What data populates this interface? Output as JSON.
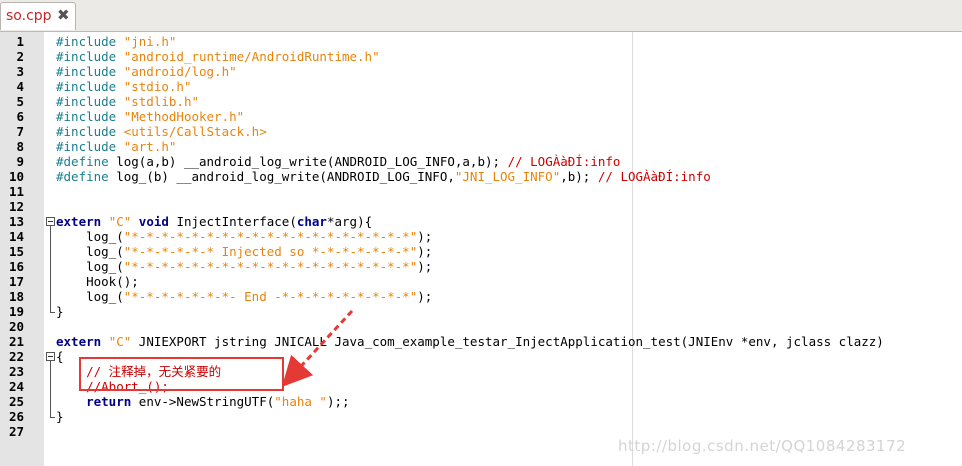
{
  "tab": {
    "label": "so.cpp",
    "close_glyph": "✖"
  },
  "editor": {
    "lines": [
      {
        "n": "1",
        "parts": [
          [
            "pp",
            "#include "
          ],
          [
            "str",
            "\"jni.h\""
          ]
        ]
      },
      {
        "n": "2",
        "parts": [
          [
            "pp",
            "#include "
          ],
          [
            "str",
            "\"android_runtime/AndroidRuntime.h\""
          ]
        ]
      },
      {
        "n": "3",
        "parts": [
          [
            "pp",
            "#include "
          ],
          [
            "str",
            "\"android/log.h\""
          ]
        ]
      },
      {
        "n": "4",
        "parts": [
          [
            "pp",
            "#include "
          ],
          [
            "str",
            "\"stdio.h\""
          ]
        ]
      },
      {
        "n": "5",
        "parts": [
          [
            "pp",
            "#include "
          ],
          [
            "str",
            "\"stdlib.h\""
          ]
        ]
      },
      {
        "n": "6",
        "parts": [
          [
            "pp",
            "#include "
          ],
          [
            "str",
            "\"MethodHooker.h\""
          ]
        ]
      },
      {
        "n": "7",
        "parts": [
          [
            "pp",
            "#include "
          ],
          [
            "str",
            "<utils/CallStack.h>"
          ]
        ]
      },
      {
        "n": "8",
        "parts": [
          [
            "pp",
            "#include "
          ],
          [
            "str",
            "\"art.h\""
          ]
        ]
      },
      {
        "n": "9",
        "parts": [
          [
            "pp",
            "#define "
          ],
          [
            "txt",
            "log(a,b) __android_log_write(ANDROID_LOG_INFO,a,b); "
          ],
          [
            "cmt",
            "// LOGÀàÐÍ:info"
          ]
        ]
      },
      {
        "n": "10",
        "parts": [
          [
            "pp",
            "#define "
          ],
          [
            "txt",
            "log_(b) __android_log_write(ANDROID_LOG_INFO,"
          ],
          [
            "str",
            "\"JNI_LOG_INFO\""
          ],
          [
            "txt",
            ",b); "
          ],
          [
            "cmt",
            "// LOGÀàÐÍ:info"
          ]
        ]
      },
      {
        "n": "11",
        "parts": []
      },
      {
        "n": "12",
        "parts": []
      },
      {
        "n": "13",
        "parts": [
          [
            "kw",
            "extern "
          ],
          [
            "str",
            "\"C\" "
          ],
          [
            "kw",
            "void "
          ],
          [
            "txt",
            "InjectInterface("
          ],
          [
            "kw",
            "char"
          ],
          [
            "txt",
            "*arg){"
          ]
        ]
      },
      {
        "n": "14",
        "parts": [
          [
            "txt",
            "    log_("
          ],
          [
            "str",
            "\"*-*-*-*-*-*-*-*-*-*-*-*-*-*-*-*-*-*-*\""
          ],
          [
            "txt",
            ");"
          ]
        ]
      },
      {
        "n": "15",
        "parts": [
          [
            "txt",
            "    log_("
          ],
          [
            "str",
            "\"*-*-*-*-*-* Injected so *-*-*-*-*-*-*\""
          ],
          [
            "txt",
            ");"
          ]
        ]
      },
      {
        "n": "16",
        "parts": [
          [
            "txt",
            "    log_("
          ],
          [
            "str",
            "\"*-*-*-*-*-*-*-*-*-*-*-*-*-*-*-*-*-*-*\""
          ],
          [
            "txt",
            ");"
          ]
        ]
      },
      {
        "n": "17",
        "parts": [
          [
            "txt",
            "    Hook();"
          ]
        ]
      },
      {
        "n": "18",
        "parts": [
          [
            "txt",
            "    log_("
          ],
          [
            "str",
            "\"*-*-*-*-*-*-*- End -*-*-*-*-*-*-*-*-*\""
          ],
          [
            "txt",
            ");"
          ]
        ]
      },
      {
        "n": "19",
        "parts": [
          [
            "txt",
            "}"
          ]
        ]
      },
      {
        "n": "20",
        "parts": []
      },
      {
        "n": "21",
        "parts": [
          [
            "kw",
            "extern "
          ],
          [
            "str",
            "\"C\" "
          ],
          [
            "txt",
            "JNIEXPORT jstring JNICALL Java_com_example_testar_InjectApplication_test(JNIEnv *env, jclass clazz)"
          ]
        ]
      },
      {
        "n": "22",
        "parts": [
          [
            "txt",
            "{"
          ]
        ]
      },
      {
        "n": "23",
        "parts": [
          [
            "txt",
            "    "
          ],
          [
            "cmt",
            "// 注释掉，无关紧要的"
          ]
        ]
      },
      {
        "n": "24",
        "parts": [
          [
            "txt",
            "    "
          ],
          [
            "cmt",
            "//Abort_();"
          ]
        ]
      },
      {
        "n": "25",
        "parts": [
          [
            "txt",
            "    "
          ],
          [
            "kw",
            "return "
          ],
          [
            "txt",
            "env->NewStringUTF("
          ],
          [
            "str",
            "\"haha \""
          ],
          [
            "txt",
            ");;"
          ]
        ]
      },
      {
        "n": "26",
        "parts": [
          [
            "txt",
            "}"
          ]
        ]
      },
      {
        "n": "27",
        "parts": []
      }
    ]
  },
  "watermark": "http://blog.csdn.net/QQ1084283172",
  "colors": {
    "preprocessor": "#1a7f8e",
    "string": "#e8840c",
    "keyword": "#00008b",
    "comment": "#cc0000",
    "annotation": "#e53935"
  }
}
